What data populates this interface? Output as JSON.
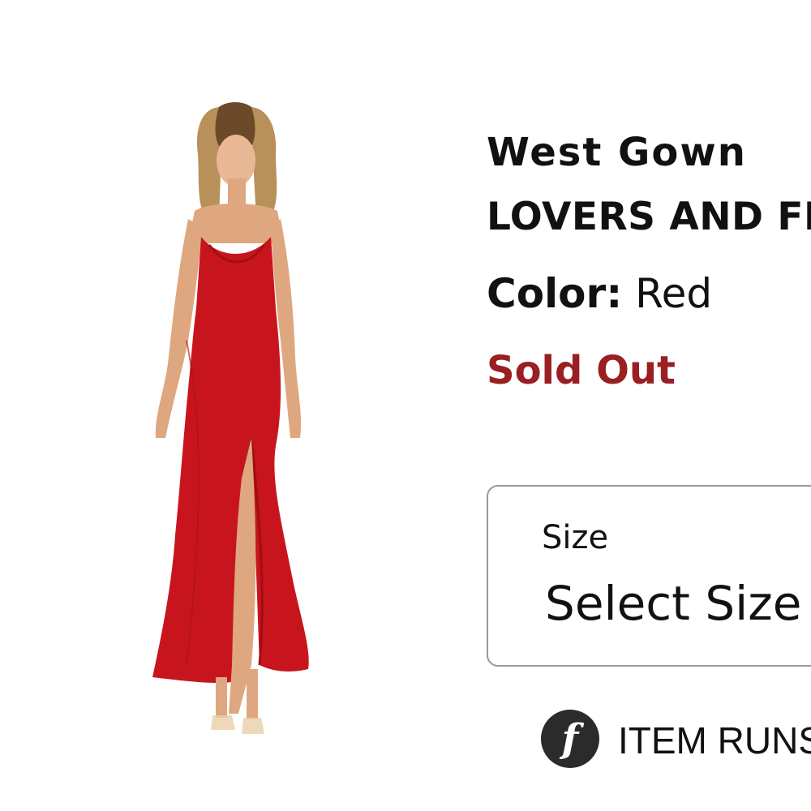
{
  "product": {
    "title": "West Gown",
    "brand": "LOVERS AND FRIENDS",
    "color_label": "Color:",
    "color_value": "Red",
    "status": "Sold Out",
    "dress_color": "#c8151d",
    "status_color": "#9a1f23"
  },
  "size_selector": {
    "label": "Size",
    "value": "Select Size"
  },
  "fit": {
    "icon": "f-logo-icon",
    "text": "ITEM RUNS"
  }
}
